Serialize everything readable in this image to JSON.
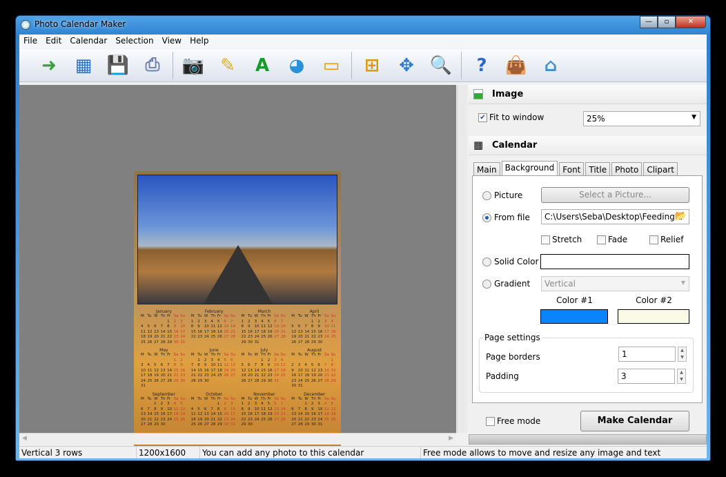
{
  "window": {
    "title": "Photo Calendar Maker",
    "minimize": "—",
    "maximize": "▫",
    "close": "✕"
  },
  "menu": [
    "File",
    "Edit",
    "Calendar",
    "Selection",
    "View",
    "Help"
  ],
  "toolbar": [
    {
      "name": "open-icon",
      "glyph": "➜",
      "color": "#3ca03c"
    },
    {
      "name": "new-calendar-icon",
      "glyph": "▦",
      "color": "#2a70c8"
    },
    {
      "name": "save-icon",
      "glyph": "💾",
      "color": "#2a4ea0"
    },
    {
      "name": "print-icon",
      "glyph": "⎙",
      "color": "#7080b0"
    },
    {
      "sep": true
    },
    {
      "name": "camera-icon",
      "glyph": "📷",
      "color": "#555"
    },
    {
      "name": "edit-note-icon",
      "glyph": "✎",
      "color": "#d8b020"
    },
    {
      "name": "text-icon",
      "glyph": "A",
      "color": "#1a9a2a"
    },
    {
      "name": "clipart-ball-icon",
      "glyph": "◕",
      "color": "#2a90d8"
    },
    {
      "name": "background-image-icon",
      "glyph": "▭",
      "color": "#d89a10"
    },
    {
      "sep": true
    },
    {
      "name": "fit-icon",
      "glyph": "⊞",
      "color": "#d89a10"
    },
    {
      "name": "move-icon",
      "glyph": "✥",
      "color": "#2a80d0"
    },
    {
      "name": "zoom-icon",
      "glyph": "🔍",
      "color": "#4a80c0"
    },
    {
      "sep": true
    },
    {
      "name": "help-icon",
      "glyph": "?",
      "color": "#2a6ad0"
    },
    {
      "name": "buy-bag-icon",
      "glyph": "👜",
      "color": "#d8a820"
    },
    {
      "name": "home-icon",
      "glyph": "⌂",
      "color": "#4a90c8"
    }
  ],
  "calendar_preview": {
    "weekday_headers": [
      "M",
      "Tu",
      "W",
      "Th",
      "Fr",
      "Sa",
      "Su"
    ],
    "months": [
      {
        "name": "January",
        "offset": 4,
        "days": 31
      },
      {
        "name": "February",
        "offset": 0,
        "days": 28
      },
      {
        "name": "March",
        "offset": 0,
        "days": 31
      },
      {
        "name": "April",
        "offset": 3,
        "days": 30
      },
      {
        "name": "May",
        "offset": 5,
        "days": 31
      },
      {
        "name": "June",
        "offset": 1,
        "days": 30
      },
      {
        "name": "July",
        "offset": 3,
        "days": 31
      },
      {
        "name": "August",
        "offset": 6,
        "days": 31
      },
      {
        "name": "September",
        "offset": 2,
        "days": 30
      },
      {
        "name": "October",
        "offset": 4,
        "days": 31
      },
      {
        "name": "November",
        "offset": 0,
        "days": 30
      },
      {
        "name": "December",
        "offset": 2,
        "days": 31
      }
    ]
  },
  "panel": {
    "image_section": "Image",
    "fit_to_window": "Fit to window",
    "fit_checked": true,
    "zoom": "25%",
    "calendar_section": "Calendar",
    "tabs": [
      "Main",
      "Background",
      "Font",
      "Title",
      "Photo",
      "Clipart"
    ],
    "active_tab": "Background",
    "picture": "Picture",
    "select_picture": "Select a Picture...",
    "from_file": "From file",
    "file_path": "C:\\Users\\Seba\\Desktop\\Feeding a",
    "stretch": "Stretch",
    "fade": "Fade",
    "relief": "Relief",
    "solid_color": "Solid Color",
    "gradient": "Gradient",
    "gradient_type": "Vertical",
    "color1_label": "Color #1",
    "color2_label": "Color #2",
    "color1": "#0a84f8",
    "color2": "#fafae6",
    "page_settings": "Page settings",
    "page_borders": "Page borders",
    "page_borders_value": "1",
    "padding": "Padding",
    "padding_value": "3",
    "free_mode": "Free mode",
    "make_calendar": "Make Calendar"
  },
  "status": [
    "Vertical 3 rows",
    "1200x1600",
    "You can add any photo to this calendar",
    "Free mode allows to move and resize any image and text"
  ]
}
